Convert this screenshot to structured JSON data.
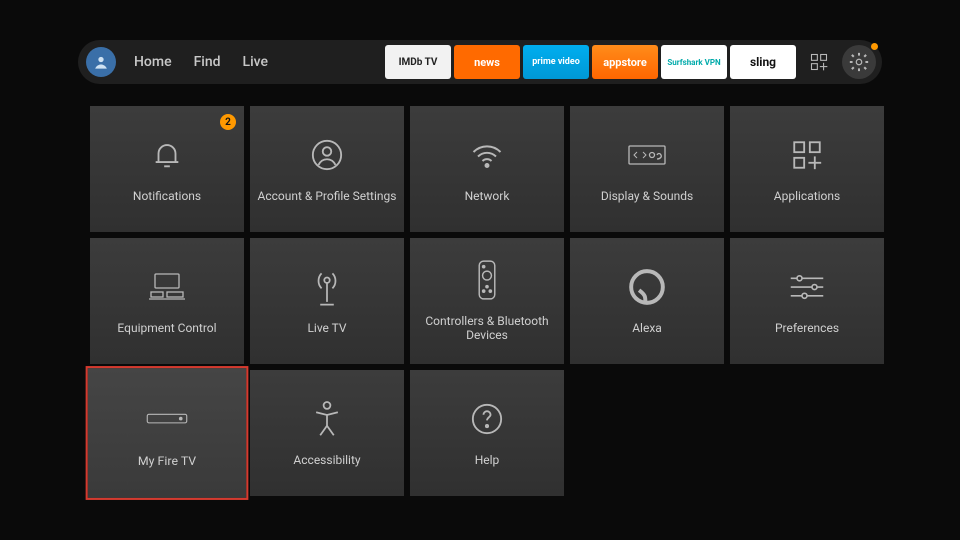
{
  "nav": {
    "links": [
      "Home",
      "Find",
      "Live"
    ]
  },
  "apps": [
    {
      "id": "imdb",
      "label": "IMDb TV",
      "bg": "app-imdb"
    },
    {
      "id": "news",
      "label": "news",
      "bg": "app-news"
    },
    {
      "id": "prime",
      "label": "prime video",
      "bg": "app-prime"
    },
    {
      "id": "appstore",
      "label": "appstore",
      "bg": "app-store"
    },
    {
      "id": "surfshark",
      "label": "Surfshark VPN",
      "bg": "app-surf"
    },
    {
      "id": "sling",
      "label": "sling",
      "bg": "app-sling"
    }
  ],
  "settings_badge": true,
  "tiles": [
    {
      "id": "notifications",
      "label": "Notifications",
      "icon": "bell",
      "badge": "2"
    },
    {
      "id": "account",
      "label": "Account & Profile Settings",
      "icon": "user"
    },
    {
      "id": "network",
      "label": "Network",
      "icon": "wifi"
    },
    {
      "id": "display",
      "label": "Display & Sounds",
      "icon": "display"
    },
    {
      "id": "applications",
      "label": "Applications",
      "icon": "apps"
    },
    {
      "id": "equipment",
      "label": "Equipment Control",
      "icon": "equip"
    },
    {
      "id": "livetv",
      "label": "Live TV",
      "icon": "antenna"
    },
    {
      "id": "controllers",
      "label": "Controllers & Bluetooth Devices",
      "icon": "remote"
    },
    {
      "id": "alexa",
      "label": "Alexa",
      "icon": "alexa"
    },
    {
      "id": "preferences",
      "label": "Preferences",
      "icon": "sliders"
    },
    {
      "id": "myfiretv",
      "label": "My Fire TV",
      "icon": "box",
      "selected": true
    },
    {
      "id": "accessibility",
      "label": "Accessibility",
      "icon": "accessibility"
    },
    {
      "id": "help",
      "label": "Help",
      "icon": "help"
    }
  ]
}
